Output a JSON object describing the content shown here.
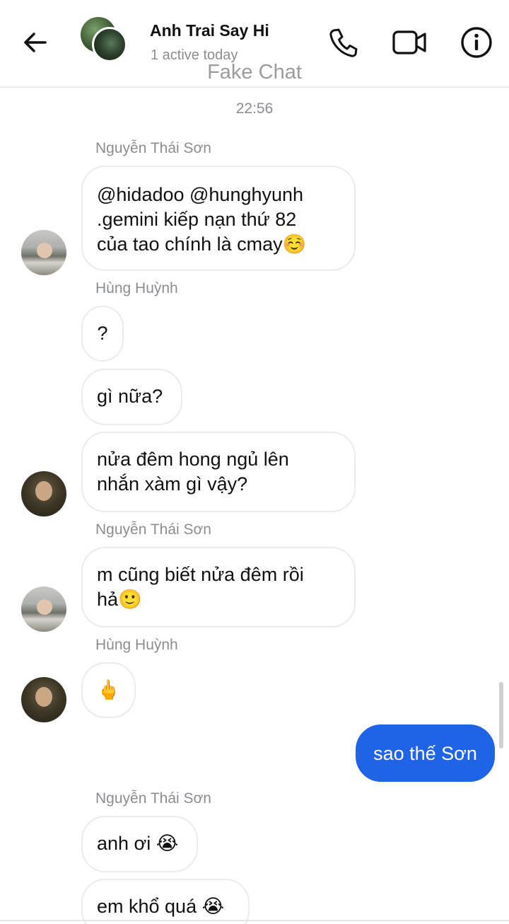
{
  "header": {
    "title": "Anh Trai Say Hi",
    "status": "1 active today",
    "watermark": "Fake Chat"
  },
  "timestamp": "22:56",
  "messages": [
    {
      "sender": "Nguyễn Thái Sơn",
      "text": "@hidadoo @hunghyunh\n.gemini kiếp nạn thứ 82\ncủa tao chính là cmay☺️"
    },
    {
      "sender": "Hùng Huỳnh",
      "text": "?"
    },
    {
      "text": "gì nữa?"
    },
    {
      "text": "nửa đêm hong ngủ lên\nnhắn xàm gì vậy?"
    },
    {
      "sender": "Nguyễn Thái Sơn",
      "text": "m cũng biết nửa đêm rồi\nhả🙂"
    },
    {
      "sender": "Hùng Huỳnh",
      "text": "🖕"
    },
    {
      "text": "sao thế Sơn"
    },
    {
      "sender": "Nguyễn Thái Sơn",
      "text": "anh ơi 😭"
    },
    {
      "text": "em khổ quá 😭"
    }
  ],
  "icons": {
    "back": "arrow-left",
    "call": "phone",
    "video": "video-camera",
    "info": "info-circle"
  },
  "colors": {
    "outgoing_bubble": "#1f63e6",
    "incoming_border": "#e9ebee",
    "muted_text": "#8a8d91"
  }
}
